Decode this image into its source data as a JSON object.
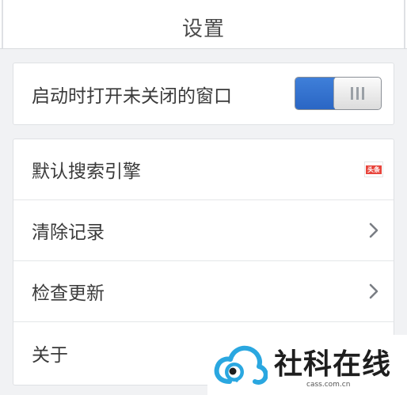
{
  "header": {
    "title": "设置"
  },
  "settings": {
    "startup_toggle": {
      "label": "启动时打开未关闭的窗口",
      "enabled": true,
      "accent_color": "#3574d4"
    },
    "items": [
      {
        "label": "默认搜索引擎",
        "trailing": "toutiao-news-icon",
        "badge_text": "头条"
      },
      {
        "label": "清除记录",
        "trailing": "chevron-right-icon"
      },
      {
        "label": "检查更新",
        "trailing": "chevron-right-icon"
      },
      {
        "label": "关于",
        "trailing": "none"
      }
    ]
  },
  "watermark": {
    "name": "社科在线",
    "domain": "cass.com.cn",
    "logo_color": "#2aa7e0"
  }
}
